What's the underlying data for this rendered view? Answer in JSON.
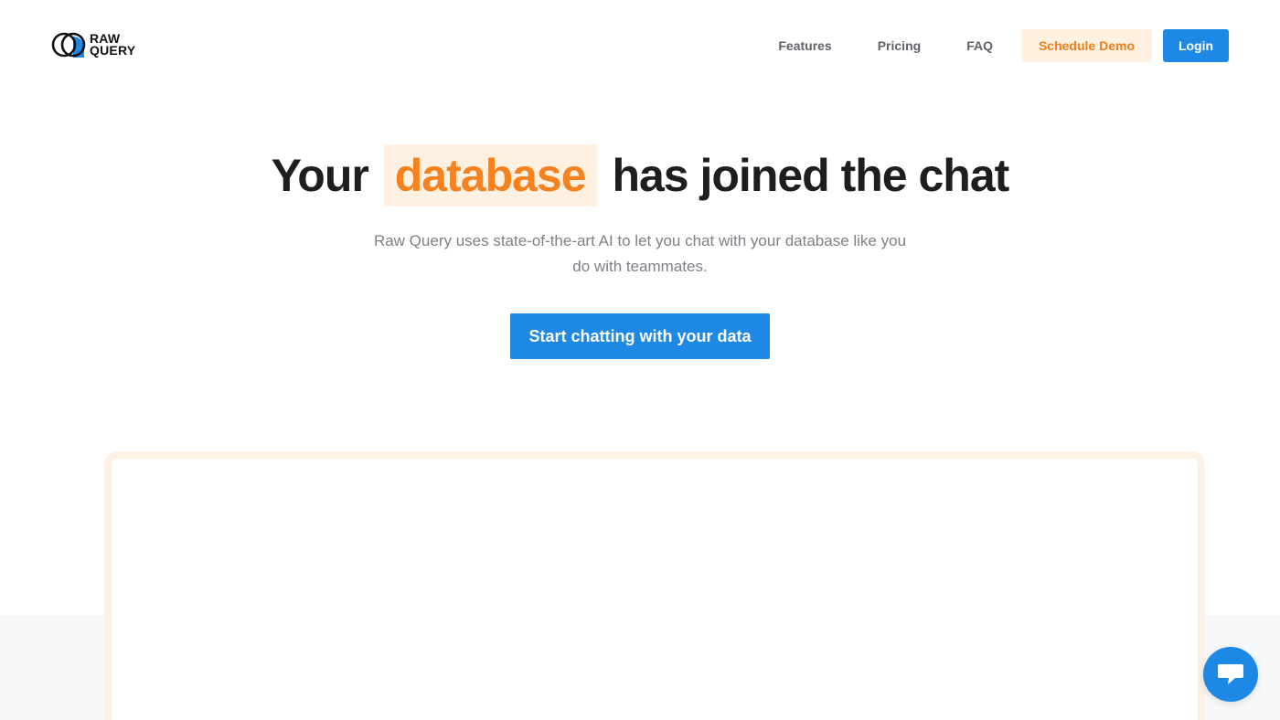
{
  "brand": {
    "line1": "RAW",
    "line2": "QUERY",
    "logo_icon": "overlapping-circles-logo"
  },
  "nav": {
    "features": "Features",
    "pricing": "Pricing",
    "faq": "FAQ",
    "schedule_demo": "Schedule Demo",
    "login": "Login"
  },
  "hero": {
    "title_before": "Your",
    "title_highlight": "database",
    "title_after": "has joined the chat",
    "subtitle": "Raw Query uses state-of-the-art AI to let you chat with your database like you do with teammates.",
    "cta": "Start chatting with your data"
  },
  "chat_widget": {
    "icon": "chat-icon"
  },
  "colors": {
    "accent_blue": "#1e88e5",
    "accent_orange": "#f5821f",
    "highlight_bg": "#fff1e2"
  }
}
